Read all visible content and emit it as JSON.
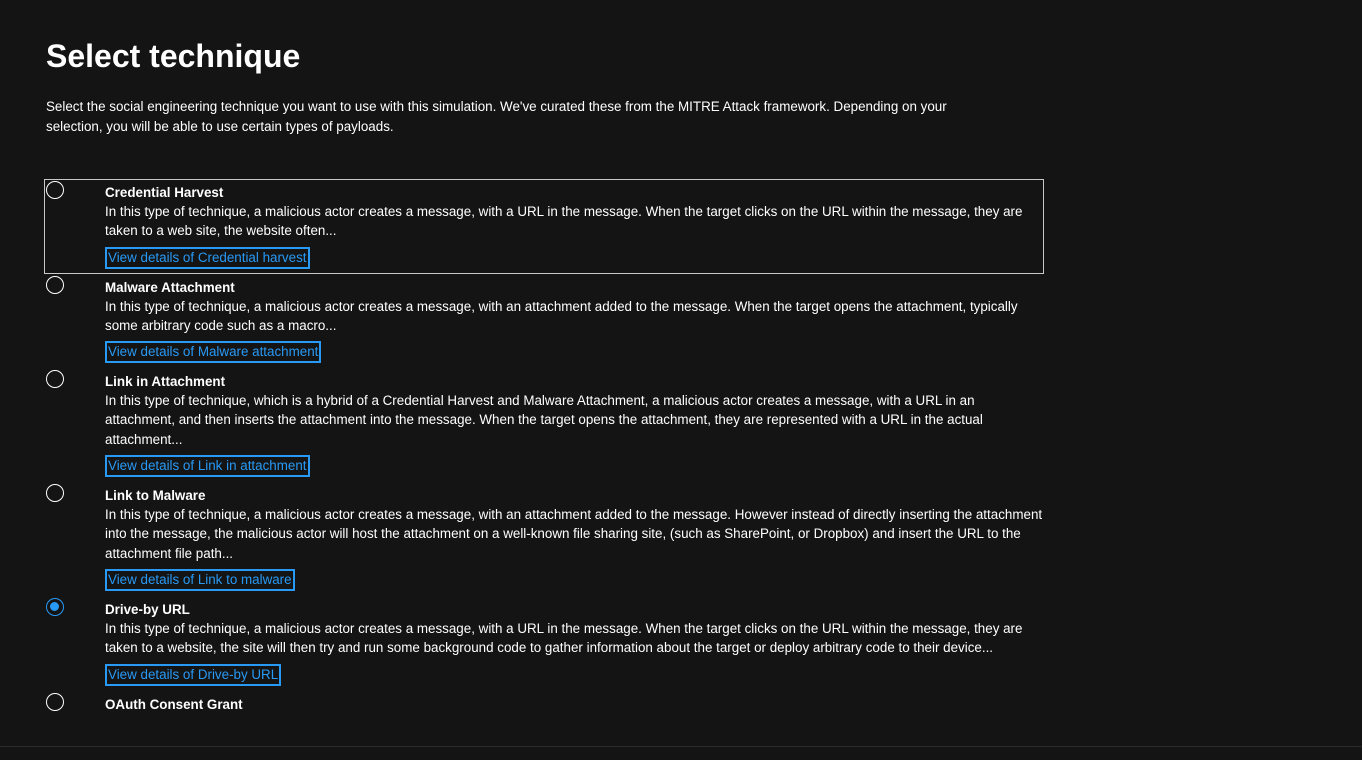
{
  "page": {
    "title": "Select technique",
    "intro": "Select the social engineering technique you want to use with this simulation. We've curated these from the MITRE Attack framework. Depending on your selection, you will be able to use certain types of payloads."
  },
  "techniques": [
    {
      "title": "Credential Harvest",
      "description": "In this type of technique, a malicious actor creates a message, with a URL in the message. When the target clicks on the URL within the message, they are taken to a web site, the website often...",
      "link": "View details of Credential harvest",
      "selected": false,
      "focused": true
    },
    {
      "title": "Malware Attachment",
      "description": "In this type of technique, a malicious actor creates a message, with an attachment added to the message. When the target opens the attachment, typically some arbitrary code such as a macro...",
      "link": "View details of Malware attachment",
      "selected": false,
      "focused": false
    },
    {
      "title": "Link in Attachment",
      "description": "In this type of technique, which is a hybrid of a Credential Harvest and Malware Attachment, a malicious actor creates a message, with a URL in an attachment, and then inserts the attachment into the message. When the target opens the attachment, they are represented with a URL in the actual attachment...",
      "link": "View details of Link in attachment",
      "selected": false,
      "focused": false
    },
    {
      "title": "Link to Malware",
      "description": "In this type of technique, a malicious actor creates a message, with an attachment added to the message. However instead of directly inserting the attachment into the message, the malicious actor will host the attachment on a well-known file sharing site, (such as SharePoint, or Dropbox) and insert the URL to the attachment file path...",
      "link": "View details of Link to malware",
      "selected": false,
      "focused": false
    },
    {
      "title": "Drive-by URL",
      "description": "In this type of technique, a malicious actor creates a message, with a URL in the message. When the target clicks on the URL within the message, they are taken to a website, the site will then try and run some background code to gather information about the target or deploy arbitrary code to their device...",
      "link": "View details of Drive-by URL",
      "selected": true,
      "focused": false
    },
    {
      "title": "OAuth Consent Grant",
      "description": "",
      "link": "",
      "selected": false,
      "focused": false
    }
  ],
  "colors": {
    "background": "#141414",
    "text": "#ffffff",
    "accent": "#2899f5",
    "focus_border": "#c8c8c8"
  }
}
